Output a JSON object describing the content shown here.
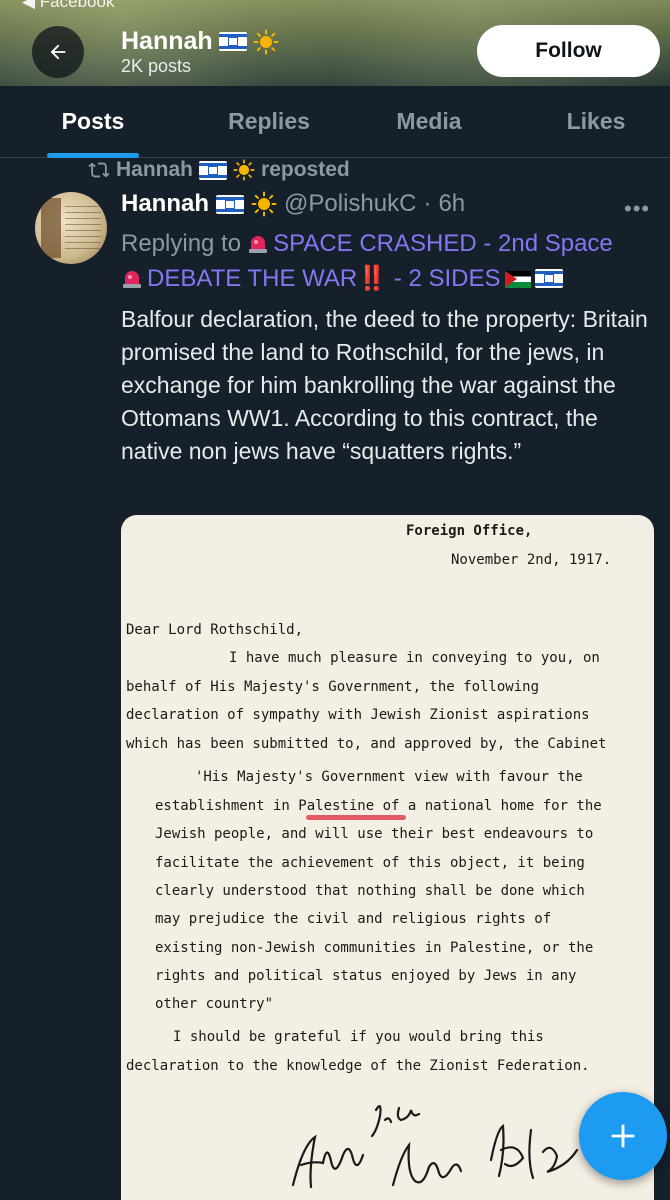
{
  "header": {
    "back_app_label": "◀ Facebook",
    "name": "Hannah",
    "post_count": "2K posts",
    "follow_label": "Follow"
  },
  "tabs": [
    {
      "label": "Posts",
      "active": true
    },
    {
      "label": "Replies",
      "active": false
    },
    {
      "label": "Media",
      "active": false
    },
    {
      "label": "Likes",
      "active": false
    }
  ],
  "post": {
    "repost_name": "Hannah",
    "repost_suffix": "reposted",
    "author_name": "Hannah",
    "author_handle": "@PolishukC",
    "time": "6h",
    "replying_prefix": "Replying to",
    "reply_part1": "SPACE CRASHED - 2nd Space",
    "reply_part2": "DEBATE THE WAR",
    "reply_bangs": "‼️",
    "reply_part3": "- 2 SIDES",
    "body": "Balfour declaration, the deed to the property: Britain promised the land to Rothschild, for the jews, in exchange for him bankrolling the war against the Ottomans WW1. According to this contract, the native non jews have “squatters rights.”"
  },
  "document": {
    "header_line1": "Foreign Office,",
    "header_line2": "November 2nd, 1917.",
    "salutation": "Dear Lord Rothschild,",
    "p1": [
      "I have much pleasure in conveying to you, on",
      "behalf of His Majesty's Government, the following",
      "declaration of sympathy with Jewish Zionist aspirations",
      "which has been submitted to, and approved by, the Cabinet"
    ],
    "quote": [
      "'His Majesty's Government view with favour the",
      "establishment in Palestine of a national home for the",
      "Jewish people, and will use their best endeavours to",
      "facilitate the achievement of this object, it being",
      "clearly understood that nothing shall be done which",
      "may prejudice the civil and religious rights of",
      "existing non-Jewish communities in Palestine, or the",
      "rights and political status enjoyed by Jews in any",
      "other country\""
    ],
    "closing": [
      "I should be grateful if you would bring this",
      "declaration to the knowledge of the Zionist Federation."
    ]
  },
  "colors": {
    "background": "#15202b",
    "accent": "#1d9bf0",
    "mention": "#8576f1",
    "muted": "#8b98a5"
  },
  "icons": {
    "back": "arrow-left-icon",
    "repost": "repost-icon",
    "more": "more-horizontal-icon",
    "compose": "plus-icon"
  }
}
